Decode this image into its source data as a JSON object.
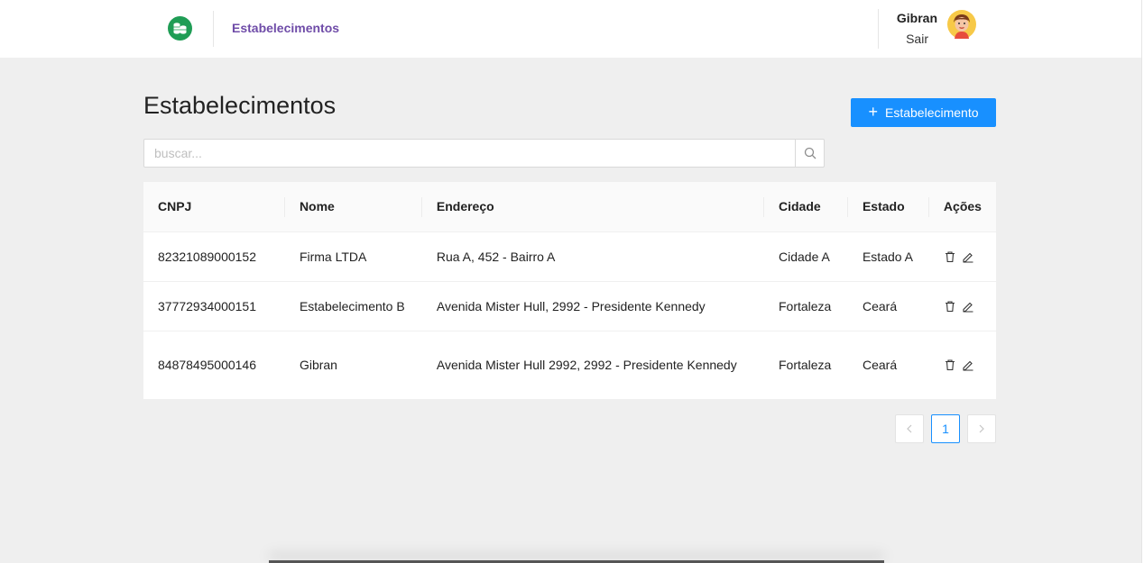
{
  "header": {
    "nav_label": "Estabelecimentos",
    "user_name": "Gibran",
    "logout_label": "Sair"
  },
  "main": {
    "title": "Estabelecimentos",
    "add_button_label": "Estabelecimento",
    "search_placeholder": "buscar..."
  },
  "table": {
    "columns": [
      "CNPJ",
      "Nome",
      "Endereço",
      "Cidade",
      "Estado",
      "Ações"
    ],
    "rows": [
      {
        "cnpj": "82321089000152",
        "nome": "Firma LTDA",
        "endereco": "Rua A, 452 - Bairro A",
        "cidade": "Cidade A",
        "estado": "Estado A"
      },
      {
        "cnpj": "37772934000151",
        "nome": "Estabelecimento B",
        "endereco": "Avenida Mister Hull, 2992 - Presidente Kennedy",
        "cidade": "Fortaleza",
        "estado": "Ceará"
      },
      {
        "cnpj": "84878495000146",
        "nome": "Gibran",
        "endereco": "Avenida Mister Hull 2992, 2992 - Presidente Kennedy",
        "cidade": "Fortaleza",
        "estado": "Ceará"
      }
    ]
  },
  "pagination": {
    "current_page": "1"
  },
  "colors": {
    "accent": "#1890ff",
    "nav": "#6f4ca8",
    "logo": "#1f9d55"
  }
}
